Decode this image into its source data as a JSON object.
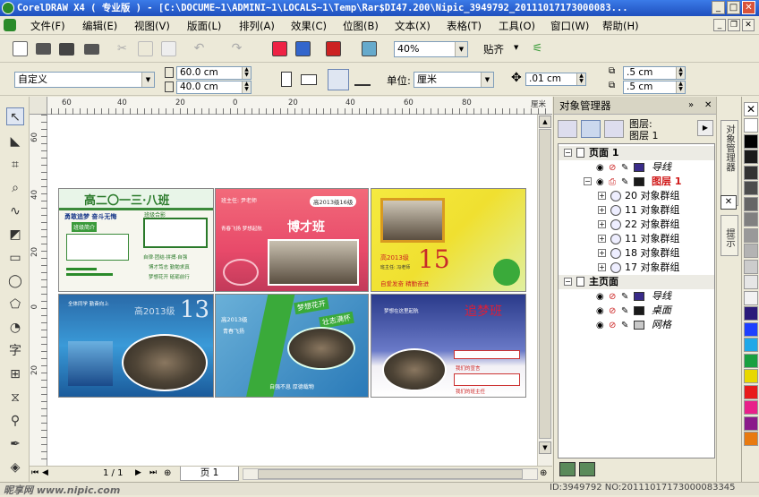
{
  "window": {
    "title": "CorelDRAW X4 ( 专业版 ) - [C:\\DOCUME~1\\ADMINI~1\\LOCALS~1\\Temp\\Rar$DI47.200\\Nipic_3949792_20111017173000083..."
  },
  "menu": [
    "文件(F)",
    "编辑(E)",
    "视图(V)",
    "版面(L)",
    "排列(A)",
    "效果(C)",
    "位图(B)",
    "文本(X)",
    "表格(T)",
    "工具(O)",
    "窗口(W)",
    "帮助(H)"
  ],
  "toolbar": {
    "zoom_value": "40%",
    "snap_label": "贴齐"
  },
  "property_bar": {
    "page_preset": "自定义",
    "width": "60.0 cm",
    "height": "40.0 cm",
    "unit_label": "单位:",
    "unit_value": "厘米",
    "nudge": ".01 cm",
    "dup_x": ".5 cm",
    "dup_y": ".5 cm"
  },
  "ruler": {
    "h_ticks": [
      "60",
      "40",
      "20",
      "0",
      "20",
      "40",
      "60",
      "80"
    ],
    "h_unit": "厘米",
    "v_ticks": [
      "60",
      "40",
      "20",
      "0",
      "20"
    ]
  },
  "page_nav": {
    "counter": "1 / 1",
    "tab": "页 1"
  },
  "canvas_panels": [
    {
      "title": "高二〇一三·八班",
      "slogan": "勇敢追梦 奋斗无悔",
      "tag1": "班级简介",
      "tag2": "班级合影",
      "line1": "自律·团结·拼搏·自强",
      "line2": "博才笃志 勤勉求真",
      "line3": "梦想花开 砥砺前行"
    },
    {
      "header": "班主任: 尹老师",
      "badge": "高2013级16级",
      "title": "博才班",
      "motto": "青春飞扬 梦想起航"
    },
    {
      "year": "高2013级",
      "sub": "班主任: 冯老师",
      "num": "15",
      "foot": "自爱发奋 精勤奋进"
    },
    {
      "header": "全体同学 勤奋向上",
      "num": "13",
      "class": "高2013级"
    },
    {
      "header": "高2013级",
      "mid": "青春飞扬",
      "banner1": "梦想花开",
      "banner2": "壮志满怀",
      "foot": "自强不息 厚德载物"
    },
    {
      "title": "追梦班",
      "line": "梦想在这里起航",
      "note1": "我们的宣言",
      "note2": "我们的班主任"
    }
  ],
  "docker": {
    "title": "对象管理器",
    "layer_label": "图层:",
    "layer_value": "图层 1",
    "rows": [
      {
        "level": 0,
        "text": "页面 1",
        "bold": true
      },
      {
        "level": 1,
        "text": "导线",
        "italic": true,
        "color": "#3a2c8a"
      },
      {
        "level": 1,
        "text": "图层 1",
        "bold": true,
        "red": true,
        "color": "#1a1a1a"
      },
      {
        "level": 2,
        "text": "20 对象群组"
      },
      {
        "level": 2,
        "text": "11 对象群组"
      },
      {
        "level": 2,
        "text": "22 对象群组"
      },
      {
        "level": 2,
        "text": "11 对象群组"
      },
      {
        "level": 2,
        "text": "18 对象群组"
      },
      {
        "level": 2,
        "text": "17 对象群组"
      },
      {
        "level": 0,
        "text": "主页面",
        "bold": true
      },
      {
        "level": 1,
        "text": "导线",
        "italic": true,
        "color": "#3a2c8a"
      },
      {
        "level": 1,
        "text": "桌面",
        "italic": true,
        "color": "#1a1a1a"
      },
      {
        "level": 1,
        "text": "网格",
        "italic": true,
        "color": "#c8c8c8"
      }
    ]
  },
  "side_tabs": {
    "tab1": "对象管理器",
    "tab2": "提示"
  },
  "palette": [
    "#ffffff",
    "#000000",
    "#1a1a1a",
    "#333333",
    "#4d4d4d",
    "#666666",
    "#808080",
    "#999999",
    "#b3b3b3",
    "#cccccc",
    "#e6e6e6",
    "#f2f2f2",
    "#2a1a7a",
    "#1e40ff",
    "#1fa8e8",
    "#19a040",
    "#e8d800",
    "#e81a1a",
    "#e8208a",
    "#8a1a8a",
    "#e87a10"
  ],
  "status": {
    "watermark": "昵享网 www.nipic.com",
    "id": "ID:3949792 NO:20111017173000083345"
  }
}
